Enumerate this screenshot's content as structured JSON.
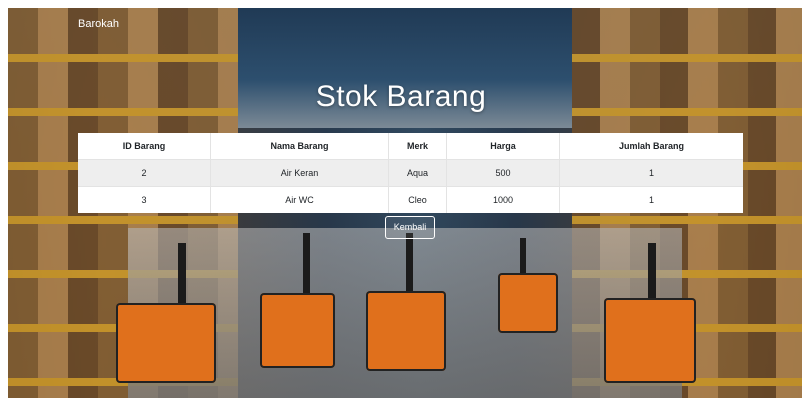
{
  "navbar": {
    "brand": "Barokah"
  },
  "page": {
    "title": "Stok Barang"
  },
  "table": {
    "headers": [
      "ID Barang",
      "Nama Barang",
      "Merk",
      "Harga",
      "Jumlah Barang"
    ],
    "rows": [
      [
        "2",
        "Air Keran",
        "Aqua",
        "500",
        "1"
      ],
      [
        "3",
        "Air WC",
        "Cleo",
        "1000",
        "1"
      ]
    ]
  },
  "actions": {
    "back_label": "Kembali"
  }
}
